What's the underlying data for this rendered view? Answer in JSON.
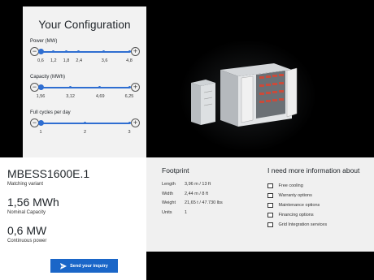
{
  "config": {
    "title": "Your Configuration",
    "params": [
      {
        "label": "Power (MW)",
        "ticks": [
          "0,6",
          "1,2",
          "1,8",
          "2,4",
          "3,6",
          "4,8"
        ],
        "selected": "0,6"
      },
      {
        "label": "Capacity (MWh)",
        "ticks": [
          "1,56",
          "3,12",
          "4,69",
          "6,25"
        ],
        "selected": "1,56"
      },
      {
        "label": "Full cycles per day",
        "ticks": [
          "1",
          "2",
          "3"
        ],
        "selected": "1"
      }
    ],
    "minus_symbol": "−",
    "plus_symbol": "+"
  },
  "spec": {
    "model": "MBESS1600E.1",
    "model_caption": "Matching variant",
    "capacity": "1,56 MWh",
    "capacity_caption": "Nominal Capacity",
    "power": "0,6 MW",
    "power_caption": "Continuous power",
    "send_label": "Send your inquiry"
  },
  "footprint": {
    "title": "Footprint",
    "rows": [
      {
        "key": "Length",
        "value": "3,96 m / 13 ft"
      },
      {
        "key": "Width",
        "value": "2,44 m / 8 ft"
      },
      {
        "key": "Weight",
        "value": "21,65 t / 47.730 lbs"
      },
      {
        "key": "Units",
        "value": "1"
      }
    ]
  },
  "more_info": {
    "title": "I need more information about",
    "options": [
      "Free cooling",
      "Warranty options",
      "Maintenance options",
      "Financing options",
      "Grid Integration services"
    ]
  },
  "colors": {
    "accent": "#1a66c8",
    "slider": "#2f6ed1",
    "panel": "#f2f2f2",
    "background": "#000000"
  }
}
